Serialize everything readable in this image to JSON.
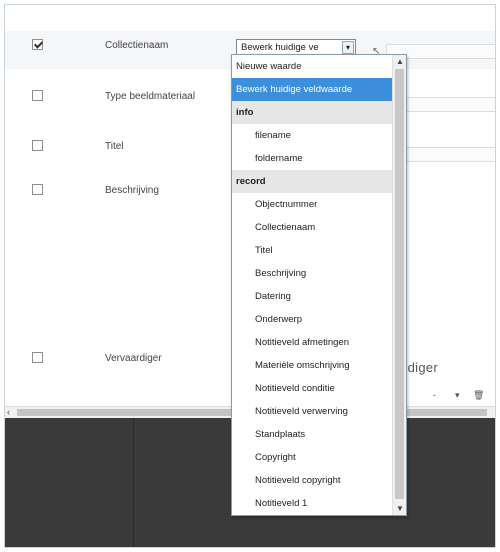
{
  "fields": [
    {
      "label": "Collectienaam",
      "checked": true
    },
    {
      "label": "Type beeldmateriaal",
      "checked": false
    },
    {
      "label": "Titel",
      "checked": false
    },
    {
      "label": "Beschrijving",
      "checked": false
    },
    {
      "label": "Vervaardiger",
      "checked": false
    }
  ],
  "select": {
    "value": "Bewerk huidige ve",
    "arrow": "▾"
  },
  "maker_partial": "rdiger",
  "toolbar": {
    "dash": "-",
    "chevron": "▾",
    "trash": "🗑"
  },
  "dropdown": {
    "items": [
      {
        "text": "Nieuwe waarde",
        "kind": "option"
      },
      {
        "text": "Bewerk huidige veldwaarde",
        "kind": "selected"
      },
      {
        "text": "info",
        "kind": "group"
      },
      {
        "text": "filename",
        "kind": "child"
      },
      {
        "text": "foldername",
        "kind": "child"
      },
      {
        "text": "record",
        "kind": "group"
      },
      {
        "text": "Objectnummer",
        "kind": "child"
      },
      {
        "text": "Collectienaam",
        "kind": "child"
      },
      {
        "text": "Titel",
        "kind": "child"
      },
      {
        "text": "Beschrijving",
        "kind": "child"
      },
      {
        "text": "Datering",
        "kind": "child"
      },
      {
        "text": "Onderwerp",
        "kind": "child"
      },
      {
        "text": "Notitieveld afmetingen",
        "kind": "child"
      },
      {
        "text": "Materiële omschrijving",
        "kind": "child"
      },
      {
        "text": "Notitieveld conditie",
        "kind": "child"
      },
      {
        "text": "Notitieveld verwerving",
        "kind": "child"
      },
      {
        "text": "Standplaats",
        "kind": "child"
      },
      {
        "text": "Copyright",
        "kind": "child"
      },
      {
        "text": "Notitieveld copyright",
        "kind": "child"
      },
      {
        "text": "Notitieveld 1",
        "kind": "child"
      }
    ]
  },
  "colors": {
    "selected": "#3c8fdc",
    "group": "#e6e6e6",
    "dark": "#3a3a3a"
  }
}
